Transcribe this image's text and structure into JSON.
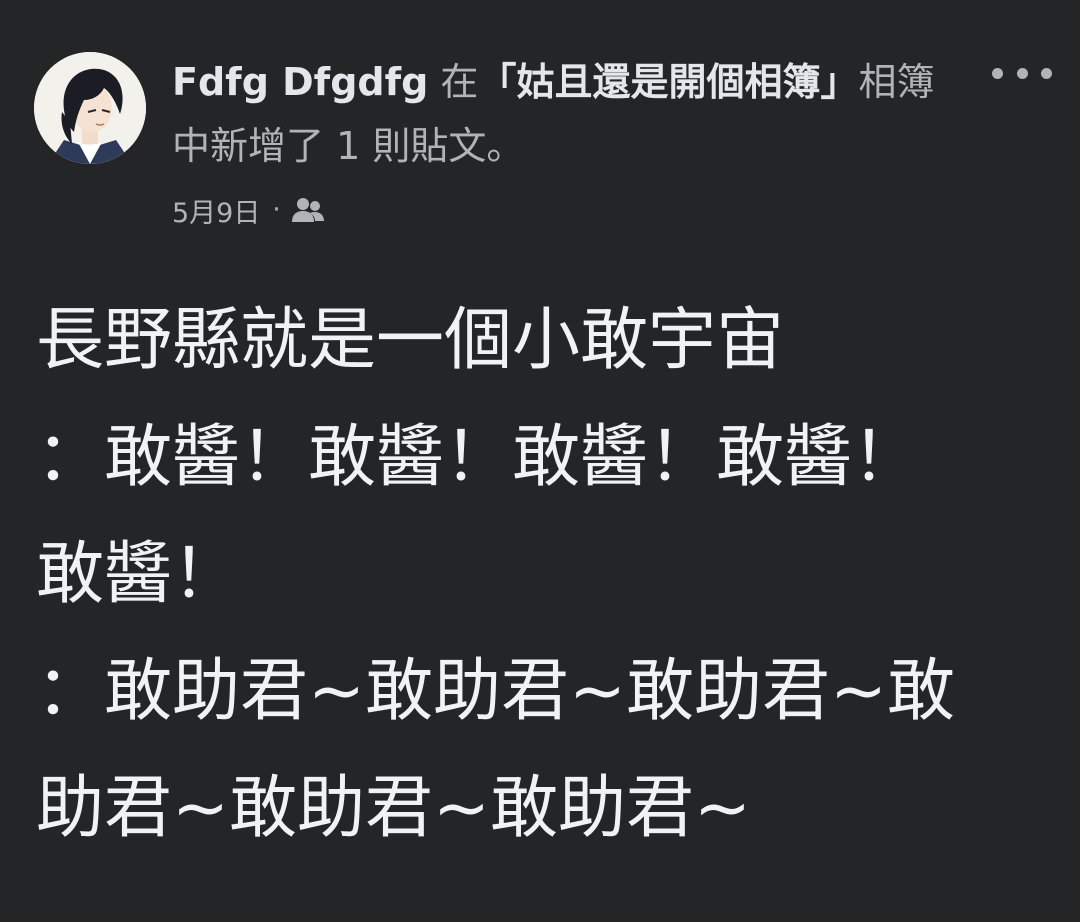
{
  "post": {
    "author": "Fdfg Dfgdfg",
    "action_prefix": " 在",
    "album": "「姑且還是開個相簿」",
    "action_suffix": "相簿中新增了 1 則貼文。",
    "date": "5月9日",
    "separator": "·",
    "privacy_icon": "friends-icon",
    "more_icon": "more-horizontal-icon",
    "body_lines": [
      "長野縣就是一個小敢宇宙",
      "：敢醬！敢醬！敢醬！敢醬！",
      "敢醬！",
      "：敢助君~敢助君~敢助君~敢",
      "助君~敢助君~敢助君~"
    ]
  },
  "colors": {
    "background": "#242526",
    "primary_text": "#e4e6eb",
    "secondary_text": "#b0b3b8"
  }
}
